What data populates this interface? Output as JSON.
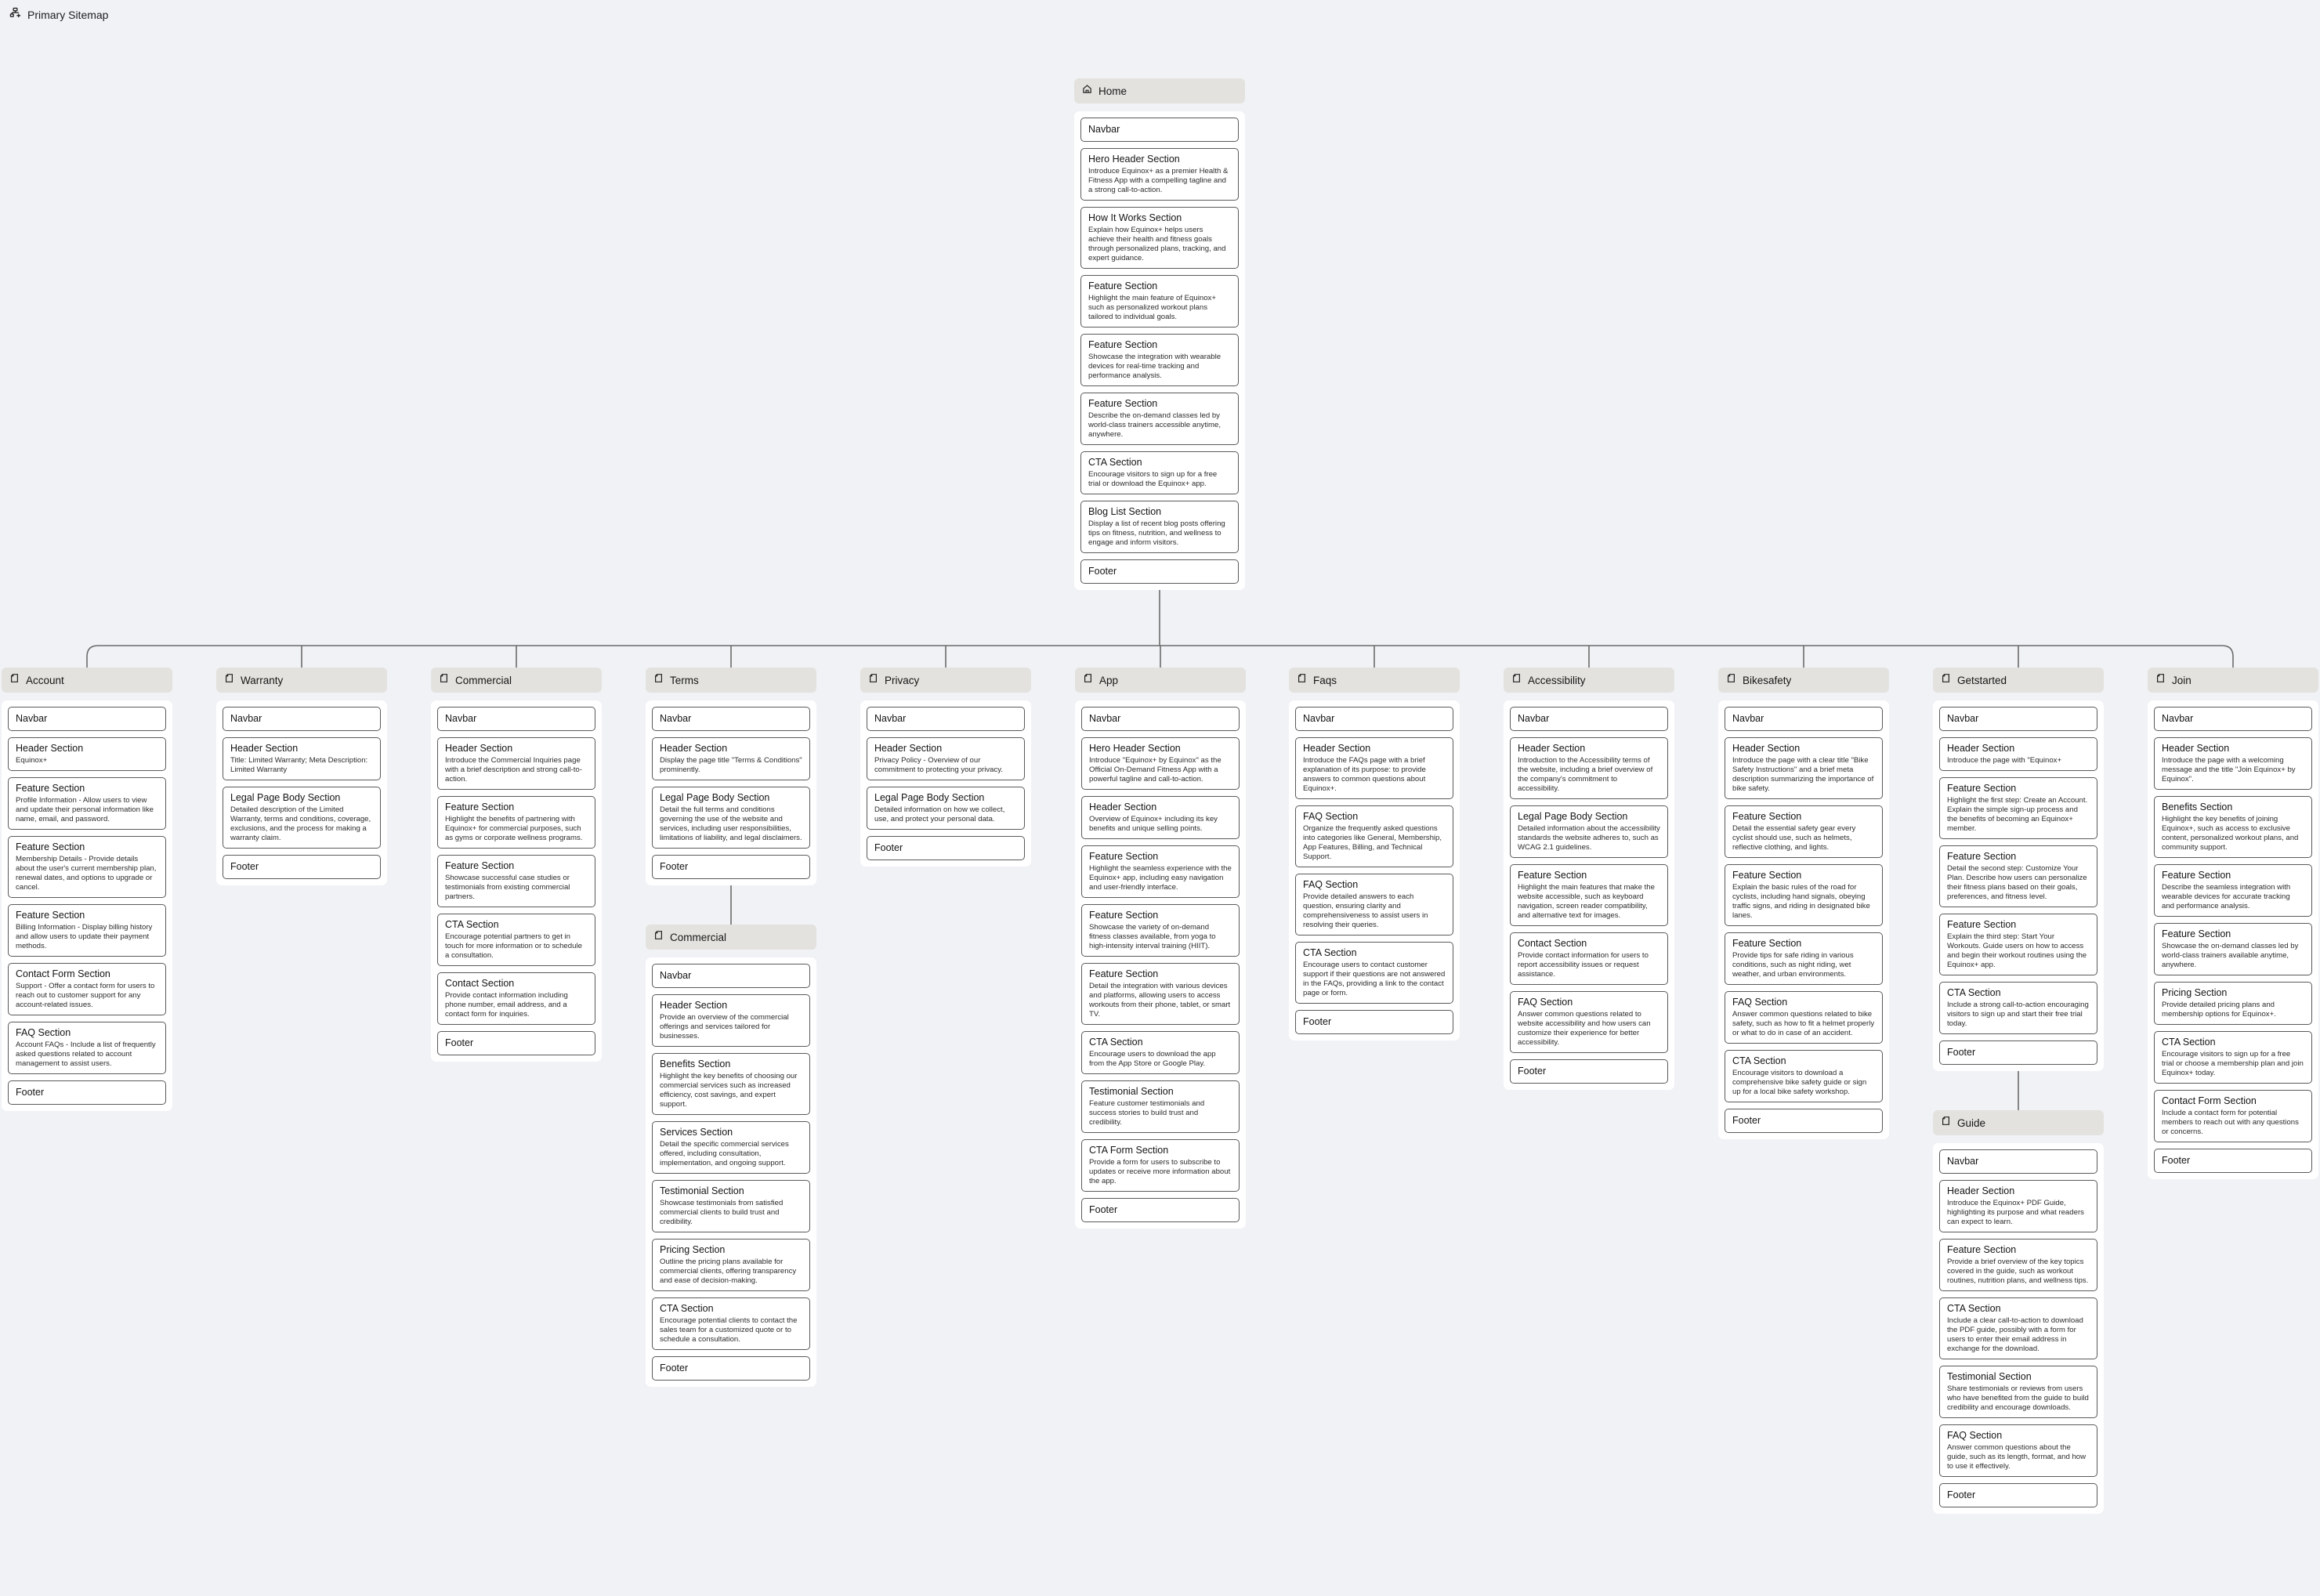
{
  "app": {
    "title": "Primary Sitemap",
    "icon": "sitemap-icon"
  },
  "colors": {
    "background": "#f1f2f6",
    "header_fill": "#e3e2de",
    "card_fill": "#ffffff",
    "section_border": "#5a5a5a",
    "connector": "#6b6b6b"
  },
  "root": {
    "id": "home",
    "title": "Home",
    "icon": "home-icon",
    "sections": [
      {
        "title": "Navbar"
      },
      {
        "title": "Hero Header Section",
        "description": "Introduce Equinox+ as a premier Health & Fitness App with a compelling tagline and a strong call-to-action."
      },
      {
        "title": "How It Works Section",
        "description": "Explain how Equinox+ helps users achieve their health and fitness goals through personalized plans, tracking, and expert guidance."
      },
      {
        "title": "Feature Section",
        "description": "Highlight the main feature of Equinox+ such as personalized workout plans tailored to individual goals."
      },
      {
        "title": "Feature Section",
        "description": "Showcase the integration with wearable devices for real-time tracking and performance analysis."
      },
      {
        "title": "Feature Section",
        "description": "Describe the on-demand classes led by world-class trainers accessible anytime, anywhere."
      },
      {
        "title": "CTA Section",
        "description": "Encourage visitors to sign up for a free trial or download the Equinox+ app."
      },
      {
        "title": "Blog List Section",
        "description": "Display a list of recent blog posts offering tips on fitness, nutrition, and wellness to engage and inform visitors."
      },
      {
        "title": "Footer"
      }
    ]
  },
  "pages": [
    {
      "id": "account",
      "title": "Account",
      "icon": "page-icon",
      "sections": [
        {
          "title": "Navbar"
        },
        {
          "title": "Header Section",
          "description": "Equinox+"
        },
        {
          "title": "Feature Section",
          "description": "Profile Information - Allow users to view and update their personal information like name, email, and password."
        },
        {
          "title": "Feature Section",
          "description": "Membership Details - Provide details about the user's current membership plan, renewal dates, and options to upgrade or cancel."
        },
        {
          "title": "Feature Section",
          "description": "Billing Information - Display billing history and allow users to update their payment methods."
        },
        {
          "title": "Contact Form Section",
          "description": "Support - Offer a contact form for users to reach out to customer support for any account-related issues."
        },
        {
          "title": "FAQ Section",
          "description": "Account FAQs - Include a list of frequently asked questions related to account management to assist users."
        },
        {
          "title": "Footer"
        }
      ]
    },
    {
      "id": "warranty",
      "title": "Warranty",
      "icon": "page-icon",
      "sections": [
        {
          "title": "Navbar"
        },
        {
          "title": "Header Section",
          "description": "Title: Limited Warranty; Meta Description: Limited Warranty"
        },
        {
          "title": "Legal Page Body Section",
          "description": "Detailed description of the Limited Warranty, terms and conditions, coverage, exclusions, and the process for making a warranty claim."
        },
        {
          "title": "Footer"
        }
      ]
    },
    {
      "id": "commercial",
      "title": "Commercial",
      "icon": "page-icon",
      "sections": [
        {
          "title": "Navbar"
        },
        {
          "title": "Header Section",
          "description": "Introduce the Commercial Inquiries page with a brief description and strong call-to-action."
        },
        {
          "title": "Feature Section",
          "description": "Highlight the benefits of partnering with Equinox+ for commercial purposes, such as gyms or corporate wellness programs."
        },
        {
          "title": "Feature Section",
          "description": "Showcase successful case studies or testimonials from existing commercial partners."
        },
        {
          "title": "CTA Section",
          "description": "Encourage potential partners to get in touch for more information or to schedule a consultation."
        },
        {
          "title": "Contact Section",
          "description": "Provide contact information including phone number, email address, and a contact form for inquiries."
        },
        {
          "title": "Footer"
        }
      ]
    },
    {
      "id": "terms",
      "title": "Terms",
      "icon": "page-icon",
      "sections": [
        {
          "title": "Navbar"
        },
        {
          "title": "Header Section",
          "description": "Display the page title \"Terms & Conditions\" prominently."
        },
        {
          "title": "Legal Page Body Section",
          "description": "Detail the full terms and conditions governing the use of the website and services, including user responsibilities, limitations of liability, and legal disclaimers."
        },
        {
          "title": "Footer"
        }
      ],
      "children": [
        {
          "id": "terms-commercial",
          "title": "Commercial",
          "icon": "page-icon",
          "sections": [
            {
              "title": "Navbar"
            },
            {
              "title": "Header Section",
              "description": "Provide an overview of the commercial offerings and services tailored for businesses."
            },
            {
              "title": "Benefits Section",
              "description": "Highlight the key benefits of choosing our commercial services such as increased efficiency, cost savings, and expert support."
            },
            {
              "title": "Services Section",
              "description": "Detail the specific commercial services offered, including consultation, implementation, and ongoing support."
            },
            {
              "title": "Testimonial Section",
              "description": "Showcase testimonials from satisfied commercial clients to build trust and credibility."
            },
            {
              "title": "Pricing Section",
              "description": "Outline the pricing plans available for commercial clients, offering transparency and ease of decision-making."
            },
            {
              "title": "CTA Section",
              "description": "Encourage potential clients to contact the sales team for a customized quote or to schedule a consultation."
            },
            {
              "title": "Footer"
            }
          ]
        }
      ]
    },
    {
      "id": "privacy",
      "title": "Privacy",
      "icon": "page-icon",
      "sections": [
        {
          "title": "Navbar"
        },
        {
          "title": "Header Section",
          "description": "Privacy Policy - Overview of our commitment to protecting your privacy."
        },
        {
          "title": "Legal Page Body Section",
          "description": "Detailed information on how we collect, use, and protect your personal data."
        },
        {
          "title": "Footer"
        }
      ]
    },
    {
      "id": "app",
      "title": "App",
      "icon": "page-icon",
      "sections": [
        {
          "title": "Navbar"
        },
        {
          "title": "Hero Header Section",
          "description": "Introduce \"Equinox+ by Equinox\" as the Official On-Demand Fitness App with a powerful tagline and call-to-action."
        },
        {
          "title": "Header Section",
          "description": "Overview of Equinox+ including its key benefits and unique selling points."
        },
        {
          "title": "Feature Section",
          "description": "Highlight the seamless experience with the Equinox+ app, including easy navigation and user-friendly interface."
        },
        {
          "title": "Feature Section",
          "description": "Showcase the variety of on-demand fitness classes available, from yoga to high-intensity interval training (HIIT)."
        },
        {
          "title": "Feature Section",
          "description": "Detail the integration with various devices and platforms, allowing users to access workouts from their phone, tablet, or smart TV."
        },
        {
          "title": "CTA Section",
          "description": "Encourage users to download the app from the App Store or Google Play."
        },
        {
          "title": "Testimonial Section",
          "description": "Feature customer testimonials and success stories to build trust and credibility."
        },
        {
          "title": "CTA Form Section",
          "description": "Provide a form for users to subscribe to updates or receive more information about the app."
        },
        {
          "title": "Footer"
        }
      ]
    },
    {
      "id": "faqs",
      "title": "Faqs",
      "icon": "page-icon",
      "sections": [
        {
          "title": "Navbar"
        },
        {
          "title": "Header Section",
          "description": "Introduce the FAQs page with a brief explanation of its purpose: to provide answers to common questions about Equinox+."
        },
        {
          "title": "FAQ Section",
          "description": "Organize the frequently asked questions into categories like General, Membership, App Features, Billing, and Technical Support."
        },
        {
          "title": "FAQ Section",
          "description": "Provide detailed answers to each question, ensuring clarity and comprehensiveness to assist users in resolving their queries."
        },
        {
          "title": "CTA Section",
          "description": "Encourage users to contact customer support if their questions are not answered in the FAQs, providing a link to the contact page or form."
        },
        {
          "title": "Footer"
        }
      ]
    },
    {
      "id": "accessibility",
      "title": "Accessibility",
      "icon": "page-icon",
      "sections": [
        {
          "title": "Navbar"
        },
        {
          "title": "Header Section",
          "description": "Introduction to the Accessibility terms of the website, including a brief overview of the company's commitment to accessibility."
        },
        {
          "title": "Legal Page Body Section",
          "description": "Detailed information about the accessibility standards the website adheres to, such as WCAG 2.1 guidelines."
        },
        {
          "title": "Feature Section",
          "description": "Highlight the main features that make the website accessible, such as keyboard navigation, screen reader compatibility, and alternative text for images."
        },
        {
          "title": "Contact Section",
          "description": "Provide contact information for users to report accessibility issues or request assistance."
        },
        {
          "title": "FAQ Section",
          "description": "Answer common questions related to website accessibility and how users can customize their experience for better accessibility."
        },
        {
          "title": "Footer"
        }
      ]
    },
    {
      "id": "bikesafety",
      "title": "Bikesafety",
      "icon": "page-icon",
      "sections": [
        {
          "title": "Navbar"
        },
        {
          "title": "Header Section",
          "description": "Introduce the page with a clear title \"Bike Safety Instructions\" and a brief meta description summarizing the importance of bike safety."
        },
        {
          "title": "Feature Section",
          "description": "Detail the essential safety gear every cyclist should use, such as helmets, reflective clothing, and lights."
        },
        {
          "title": "Feature Section",
          "description": "Explain the basic rules of the road for cyclists, including hand signals, obeying traffic signs, and riding in designated bike lanes."
        },
        {
          "title": "Feature Section",
          "description": "Provide tips for safe riding in various conditions, such as night riding, wet weather, and urban environments."
        },
        {
          "title": "FAQ Section",
          "description": "Answer common questions related to bike safety, such as how to fit a helmet properly or what to do in case of an accident."
        },
        {
          "title": "CTA Section",
          "description": "Encourage visitors to download a comprehensive bike safety guide or sign up for a local bike safety workshop."
        },
        {
          "title": "Footer"
        }
      ]
    },
    {
      "id": "getstarted",
      "title": "Getstarted",
      "icon": "page-icon",
      "sections": [
        {
          "title": "Navbar"
        },
        {
          "title": "Header Section",
          "description": "Introduce the page with \"Equinox+"
        },
        {
          "title": "Feature Section",
          "description": "Highlight the first step: Create an Account. Explain the simple sign-up process and the benefits of becoming an Equinox+ member."
        },
        {
          "title": "Feature Section",
          "description": "Detail the second step: Customize Your Plan. Describe how users can personalize their fitness plans based on their goals, preferences, and fitness level."
        },
        {
          "title": "Feature Section",
          "description": "Explain the third step: Start Your Workouts. Guide users on how to access and begin their workout routines using the Equinox+ app."
        },
        {
          "title": "CTA Section",
          "description": "Include a strong call-to-action encouraging visitors to sign up and start their free trial today."
        },
        {
          "title": "Footer"
        }
      ],
      "children": [
        {
          "id": "guide",
          "title": "Guide",
          "icon": "page-icon",
          "sections": [
            {
              "title": "Navbar"
            },
            {
              "title": "Header Section",
              "description": "Introduce the Equinox+ PDF Guide, highlighting its purpose and what readers can expect to learn."
            },
            {
              "title": "Feature Section",
              "description": "Provide a brief overview of the key topics covered in the guide, such as workout routines, nutrition plans, and wellness tips."
            },
            {
              "title": "CTA Section",
              "description": "Include a clear call-to-action to download the PDF guide, possibly with a form for users to enter their email address in exchange for the download."
            },
            {
              "title": "Testimonial Section",
              "description": "Share testimonials or reviews from users who have benefited from the guide to build credibility and encourage downloads."
            },
            {
              "title": "FAQ Section",
              "description": "Answer common questions about the guide, such as its length, format, and how to use it effectively."
            },
            {
              "title": "Footer"
            }
          ]
        }
      ]
    },
    {
      "id": "join",
      "title": "Join",
      "icon": "page-icon",
      "sections": [
        {
          "title": "Navbar"
        },
        {
          "title": "Header Section",
          "description": "Introduce the page with a welcoming message and the title \"Join Equinox+ by Equinox\"."
        },
        {
          "title": "Benefits Section",
          "description": "Highlight the key benefits of joining Equinox+, such as access to exclusive content, personalized workout plans, and community support."
        },
        {
          "title": "Feature Section",
          "description": "Describe the seamless integration with wearable devices for accurate tracking and performance analysis."
        },
        {
          "title": "Feature Section",
          "description": "Showcase the on-demand classes led by world-class trainers available anytime, anywhere."
        },
        {
          "title": "Pricing Section",
          "description": "Provide detailed pricing plans and membership options for Equinox+."
        },
        {
          "title": "CTA Section",
          "description": "Encourage visitors to sign up for a free trial or choose a membership plan and join Equinox+ today."
        },
        {
          "title": "Contact Form Section",
          "description": "Include a contact form for potential members to reach out with any questions or concerns."
        },
        {
          "title": "Footer"
        }
      ]
    }
  ]
}
